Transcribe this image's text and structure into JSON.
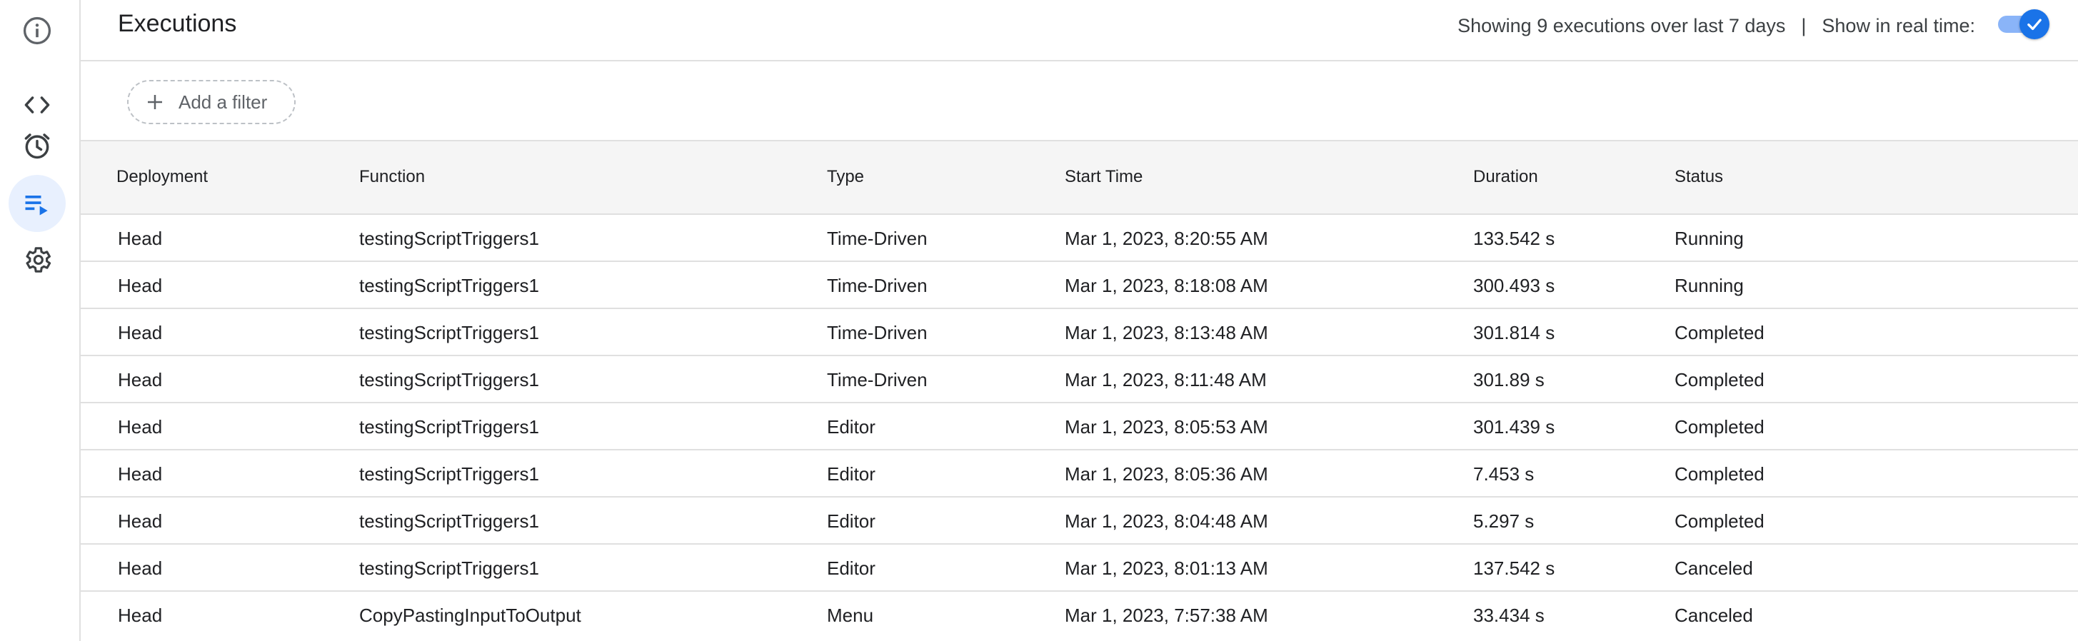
{
  "header": {
    "title": "Executions",
    "summary": "Showing 9 executions over last 7 days",
    "separator": "|",
    "realtime_label": "Show in real time:",
    "realtime_enabled": true
  },
  "filter": {
    "add_label": "Add a filter"
  },
  "nav": {
    "items": [
      {
        "name": "overview",
        "icon": "info-icon"
      },
      {
        "name": "editor",
        "icon": "code-icon"
      },
      {
        "name": "triggers",
        "icon": "alarm-clock-icon"
      },
      {
        "name": "executions",
        "icon": "executions-list-icon",
        "active": true
      },
      {
        "name": "settings",
        "icon": "gear-icon"
      }
    ]
  },
  "table": {
    "columns": [
      "Deployment",
      "Function",
      "Type",
      "Start Time",
      "Duration",
      "Status"
    ],
    "rows": [
      {
        "deployment": "Head",
        "function": "testingScriptTriggers1",
        "type": "Time-Driven",
        "start": "Mar 1, 2023, 8:20:55 AM",
        "duration": "133.542 s",
        "status": "Running"
      },
      {
        "deployment": "Head",
        "function": "testingScriptTriggers1",
        "type": "Time-Driven",
        "start": "Mar 1, 2023, 8:18:08 AM",
        "duration": "300.493 s",
        "status": "Running"
      },
      {
        "deployment": "Head",
        "function": "testingScriptTriggers1",
        "type": "Time-Driven",
        "start": "Mar 1, 2023, 8:13:48 AM",
        "duration": "301.814 s",
        "status": "Completed"
      },
      {
        "deployment": "Head",
        "function": "testingScriptTriggers1",
        "type": "Time-Driven",
        "start": "Mar 1, 2023, 8:11:48 AM",
        "duration": "301.89 s",
        "status": "Completed"
      },
      {
        "deployment": "Head",
        "function": "testingScriptTriggers1",
        "type": "Editor",
        "start": "Mar 1, 2023, 8:05:53 AM",
        "duration": "301.439 s",
        "status": "Completed"
      },
      {
        "deployment": "Head",
        "function": "testingScriptTriggers1",
        "type": "Editor",
        "start": "Mar 1, 2023, 8:05:36 AM",
        "duration": "7.453 s",
        "status": "Completed"
      },
      {
        "deployment": "Head",
        "function": "testingScriptTriggers1",
        "type": "Editor",
        "start": "Mar 1, 2023, 8:04:48 AM",
        "duration": "5.297 s",
        "status": "Completed"
      },
      {
        "deployment": "Head",
        "function": "testingScriptTriggers1",
        "type": "Editor",
        "start": "Mar 1, 2023, 8:01:13 AM",
        "duration": "137.542 s",
        "status": "Canceled"
      },
      {
        "deployment": "Head",
        "function": "CopyPastingInputToOutput",
        "type": "Menu",
        "start": "Mar 1, 2023, 7:57:38 AM",
        "duration": "33.434 s",
        "status": "Canceled"
      }
    ]
  },
  "colors": {
    "accent": "#1a73e8",
    "active_nav_bg": "#e8f0fe",
    "header_bg": "#f5f5f5",
    "divider": "#e0e0e0"
  }
}
